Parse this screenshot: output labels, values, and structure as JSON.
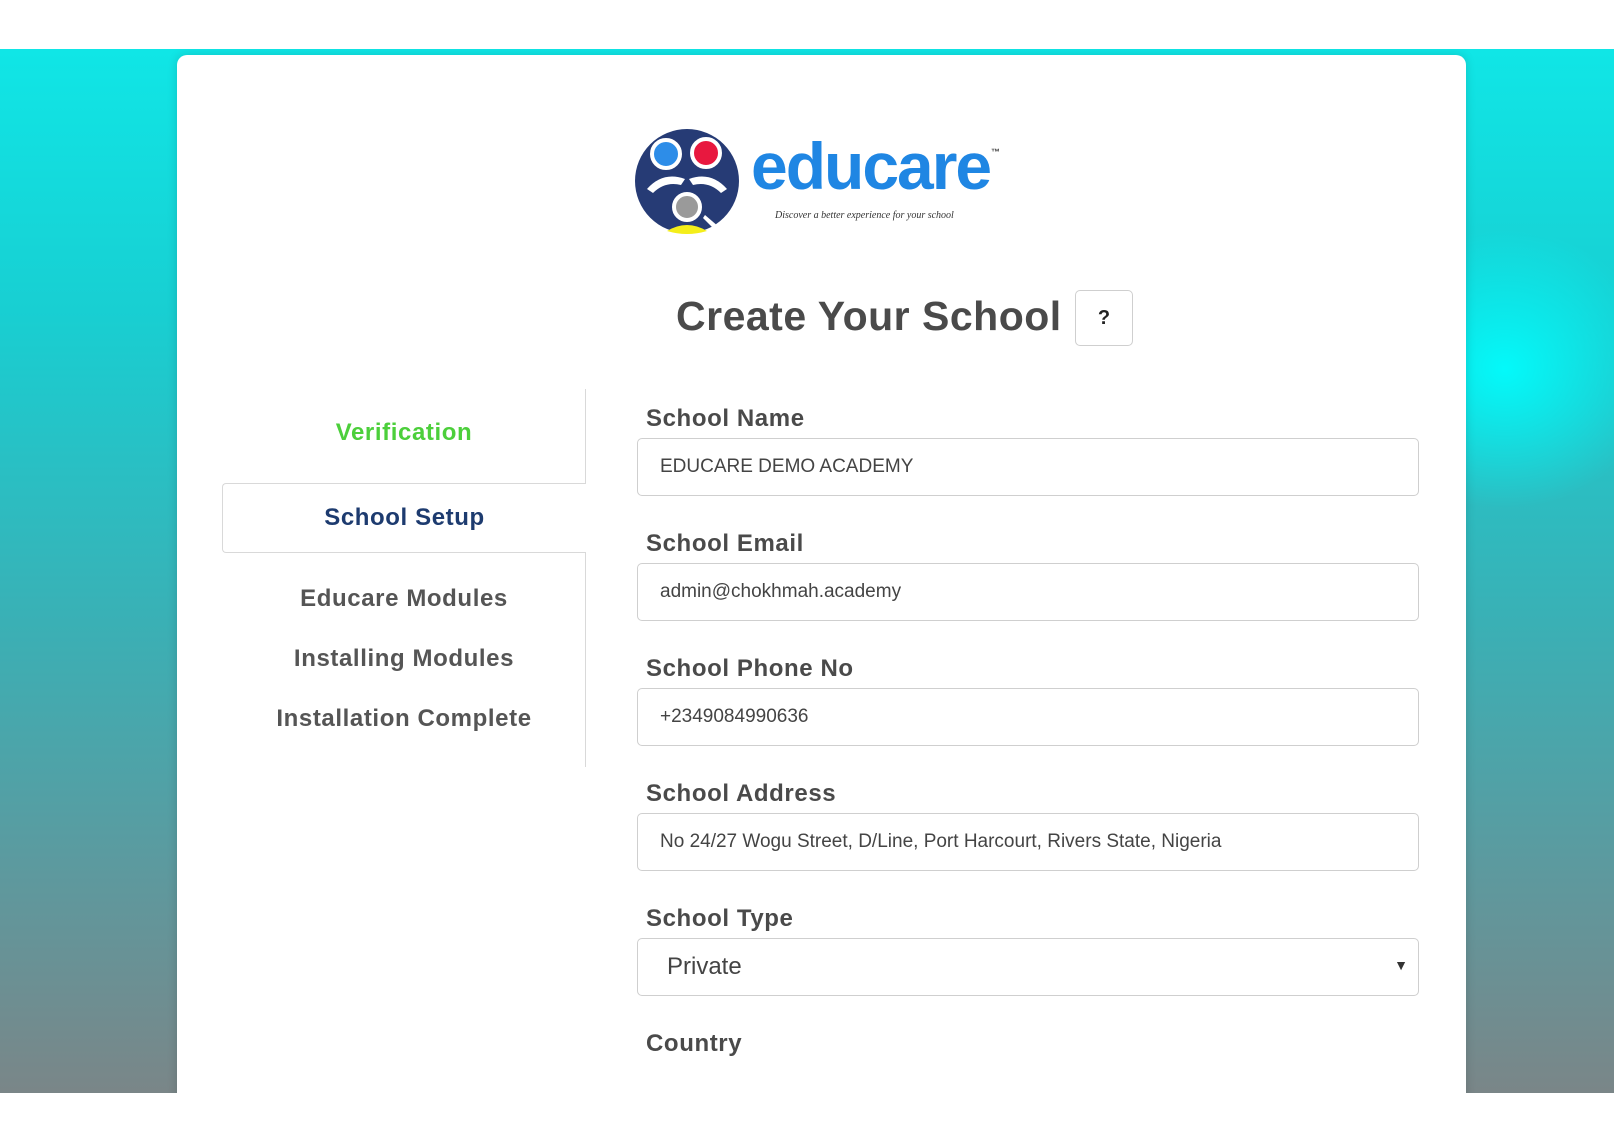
{
  "brand": {
    "name": "educare",
    "trademark": "™",
    "tagline": "Discover a better experience for your school",
    "colors": {
      "word": "#1f86e3",
      "navy": "#263b75",
      "blue_dot": "#2d8de8",
      "red_dot": "#e8183f",
      "grey_dot": "#9a9a9a",
      "yellow": "#f4ee1a"
    }
  },
  "header": {
    "title": "Create Your School",
    "help_label": "?"
  },
  "steps": {
    "items": [
      {
        "label": "Verification",
        "state": "completed"
      },
      {
        "label": "School Setup",
        "state": "active"
      },
      {
        "label": "Educare Modules",
        "state": "pending"
      },
      {
        "label": "Installing Modules",
        "state": "pending"
      },
      {
        "label": "Installation Complete",
        "state": "pending"
      }
    ],
    "colors": {
      "completed": "#4ccf3b",
      "active": "#1d3b6f",
      "pending": "#555555"
    }
  },
  "form": {
    "school_name": {
      "label": "School Name",
      "value": "EDUCARE DEMO ACADEMY"
    },
    "school_email": {
      "label": "School Email",
      "value": "admin@chokhmah.academy"
    },
    "school_phone": {
      "label": "School Phone No",
      "value": "+2349084990636"
    },
    "school_address": {
      "label": "School Address",
      "value": "No 24/27 Wogu Street, D/Line, Port Harcourt, Rivers State, Nigeria"
    },
    "school_type": {
      "label": "School Type",
      "value": "Private"
    },
    "country": {
      "label": "Country"
    }
  }
}
